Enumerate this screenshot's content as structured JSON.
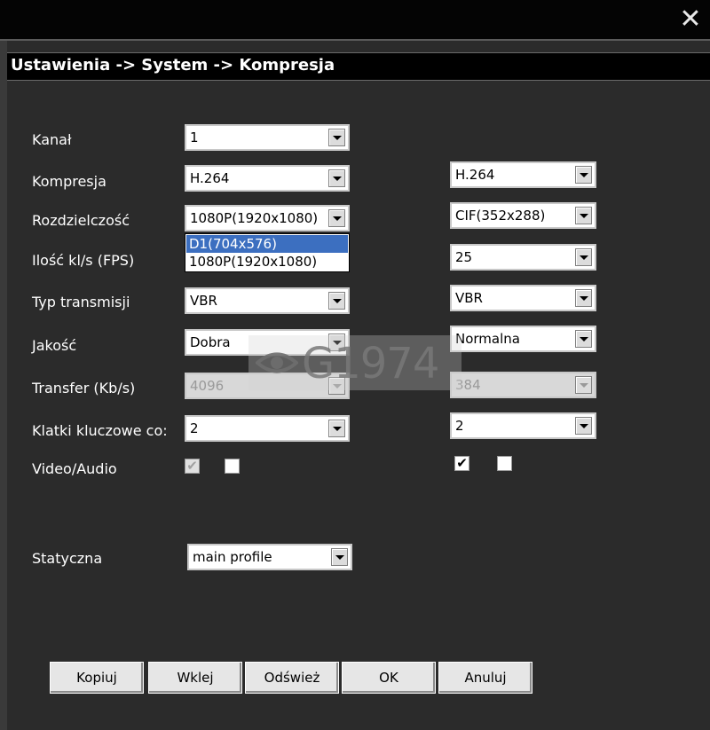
{
  "window": {
    "close_glyph": "✕"
  },
  "dialog": {
    "title": "Ustawienia -> System -> Kompresja"
  },
  "labels": {
    "channel": "Kanał",
    "compression": "Kompresja",
    "resolution": "Rozdzielczość",
    "fps": "Ilość kl/s (FPS)",
    "transmission_type": "Typ transmisji",
    "quality": "Jakość",
    "bitrate": "Transfer (Kb/s)",
    "keyframes": "Klatki kluczowe co:",
    "video_audio": "Video/Audio",
    "static": "Statyczna"
  },
  "main_stream": {
    "channel": "1",
    "compression": "H.264",
    "resolution": "1080P(1920x1080)",
    "quality": "Dobra",
    "transmission_type": "VBR",
    "bitrate": "4096",
    "keyframes": "2",
    "video_checked": true,
    "audio_checked": false
  },
  "resolution_dropdown": {
    "options": [
      "D1(704x576)",
      "1080P(1920x1080)"
    ],
    "highlighted": "D1(704x576)"
  },
  "extra_stream": {
    "compression": "H.264",
    "resolution": "CIF(352x288)",
    "fps": "25",
    "transmission_type": "VBR",
    "quality": "Normalna",
    "bitrate": "384",
    "keyframes": "2",
    "video_checked": true,
    "audio_checked": false
  },
  "static_profile": "main profile",
  "buttons": {
    "copy": "Kopiuj",
    "paste": "Wklej",
    "refresh": "Odśwież",
    "ok": "OK",
    "cancel": "Anuluj"
  },
  "watermark": {
    "text": "G1974"
  },
  "colors": {
    "background": "#2b2b2b",
    "titlebar": "#000000",
    "highlight": "#3c6fc0"
  },
  "checkmark_glyph": "✔"
}
